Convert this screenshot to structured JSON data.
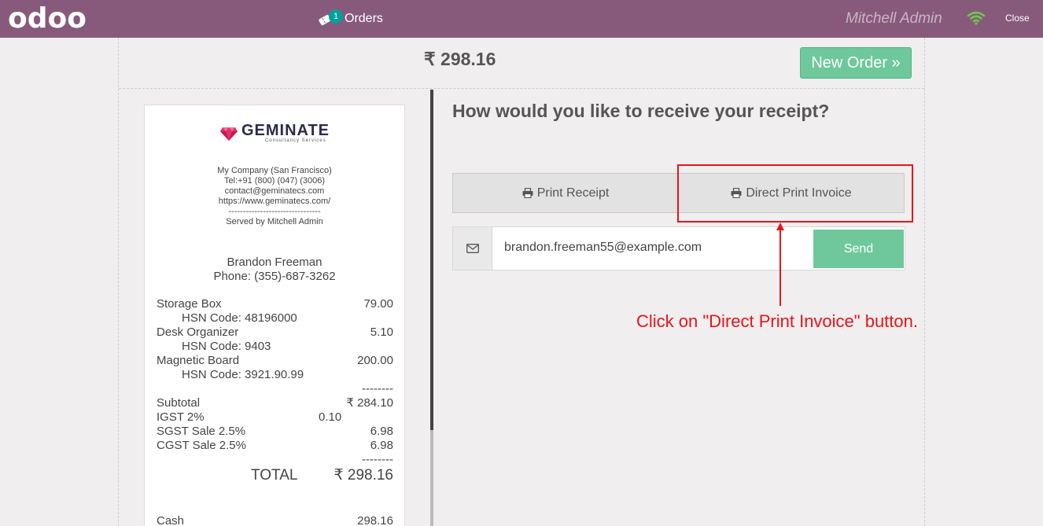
{
  "topbar": {
    "logo": "odoo",
    "orders_label": "Orders",
    "orders_badge": "1",
    "user_name": "Mitchell Admin",
    "close_label": "Close"
  },
  "header": {
    "total": "₹ 298.16",
    "new_order_label": "New Order »"
  },
  "receipt": {
    "brand_name": "GEMINATE",
    "brand_sub": "Consultancy Services",
    "company_lines": [
      "My Company (San Francisco)",
      "Tel:+91 (800) (047) (3006)",
      "contact@geminatecs.com",
      "https://www.geminatecs.com/",
      "--------------------------------",
      "Served by Mitchell Admin"
    ],
    "customer_name": "Brandon Freeman",
    "customer_phone": "Phone: (355)-687-3262",
    "items": [
      {
        "name": "Storage Box",
        "price": "79.00",
        "hsn": "HSN Code: 48196000"
      },
      {
        "name": "Desk Organizer",
        "price": "5.10",
        "hsn": "HSN Code: 9403"
      },
      {
        "name": "Magnetic Board",
        "price": "200.00",
        "hsn": "HSN Code: 3921.90.99"
      }
    ],
    "dash": "--------",
    "subtotal_label": "Subtotal",
    "subtotal_value": "₹ 284.10",
    "taxes": [
      {
        "label": "IGST 2%",
        "mid": "0.10",
        "value": ""
      },
      {
        "label": "SGST Sale 2.5%",
        "mid": "",
        "value": "6.98"
      },
      {
        "label": "CGST Sale 2.5%",
        "mid": "",
        "value": "6.98"
      }
    ],
    "total_label": "TOTAL",
    "total_value": "₹ 298.16",
    "cash_label": "Cash",
    "cash_value": "298.16"
  },
  "panel": {
    "question": "How would you like to receive your receipt?",
    "print_receipt_label": "Print Receipt",
    "direct_print_label": "Direct Print Invoice",
    "email_value": "brandon.freeman55@example.com",
    "send_label": "Send"
  },
  "annotation": {
    "text": "Click on \"Direct Print Invoice\" button.",
    "color": "#e8141b"
  },
  "colors": {
    "topbar": "#875a7b",
    "accent_green": "#6ec89b",
    "badge": "#00a09d"
  }
}
